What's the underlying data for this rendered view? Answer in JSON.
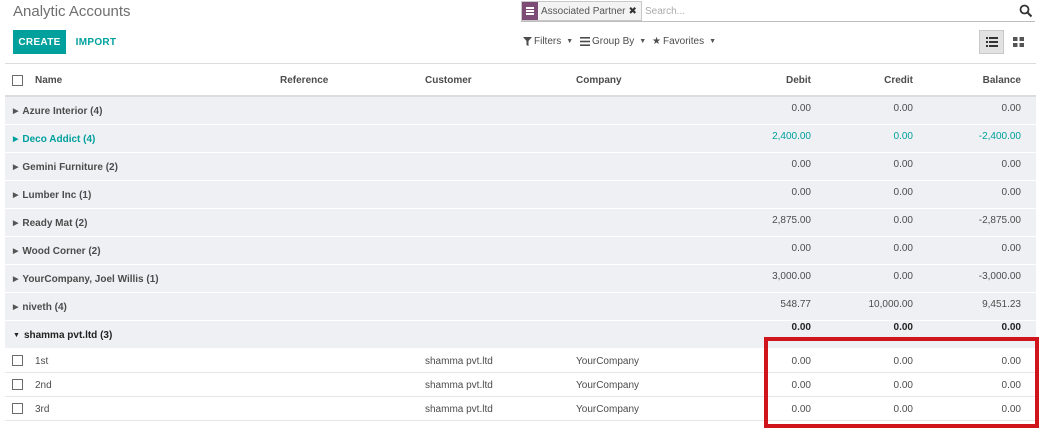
{
  "header": {
    "title": "Analytic Accounts",
    "search": {
      "facet_label": "Associated Partner",
      "facet_remove": "✖",
      "placeholder": "Search...",
      "value": ""
    },
    "create_label": "CREATE",
    "import_label": "IMPORT",
    "filters_label": "Filters",
    "groupby_label": "Group By",
    "favorites_label": "Favorites"
  },
  "colors": {
    "accent": "#00a09d",
    "facet": "#7c4c77",
    "highlight": "#d0141c",
    "group_bg": "#eef0f3"
  },
  "table": {
    "columns": [
      "Name",
      "Reference",
      "Customer",
      "Company",
      "Debit",
      "Credit",
      "Balance"
    ],
    "groups": [
      {
        "name": "Azure Interior (4)",
        "debit": "0.00",
        "credit": "0.00",
        "balance": "0.00"
      },
      {
        "name": "Deco Addict (4)",
        "debit": "2,400.00",
        "credit": "0.00",
        "balance": "-2,400.00"
      },
      {
        "name": "Gemini Furniture (2)",
        "debit": "0.00",
        "credit": "0.00",
        "balance": "0.00"
      },
      {
        "name": "Lumber Inc (1)",
        "debit": "0.00",
        "credit": "0.00",
        "balance": "0.00"
      },
      {
        "name": "Ready Mat (2)",
        "debit": "2,875.00",
        "credit": "0.00",
        "balance": "-2,875.00"
      },
      {
        "name": "Wood Corner (2)",
        "debit": "0.00",
        "credit": "0.00",
        "balance": "0.00"
      },
      {
        "name": "YourCompany, Joel Willis (1)",
        "debit": "3,000.00",
        "credit": "0.00",
        "balance": "-3,000.00"
      },
      {
        "name": "niveth (4)",
        "debit": "548.77",
        "credit": "10,000.00",
        "balance": "9,451.23"
      },
      {
        "name": "shamma pvt.ltd (3)",
        "debit": "0.00",
        "credit": "0.00",
        "balance": "0.00"
      }
    ],
    "rows": [
      {
        "name": "1st",
        "reference": "",
        "customer": "shamma pvt.ltd",
        "company": "YourCompany",
        "debit": "0.00",
        "credit": "0.00",
        "balance": "0.00"
      },
      {
        "name": "2nd",
        "reference": "",
        "customer": "shamma pvt.ltd",
        "company": "YourCompany",
        "debit": "0.00",
        "credit": "0.00",
        "balance": "0.00"
      },
      {
        "name": "3rd",
        "reference": "",
        "customer": "shamma pvt.ltd",
        "company": "YourCompany",
        "debit": "0.00",
        "credit": "0.00",
        "balance": "0.00"
      }
    ]
  }
}
